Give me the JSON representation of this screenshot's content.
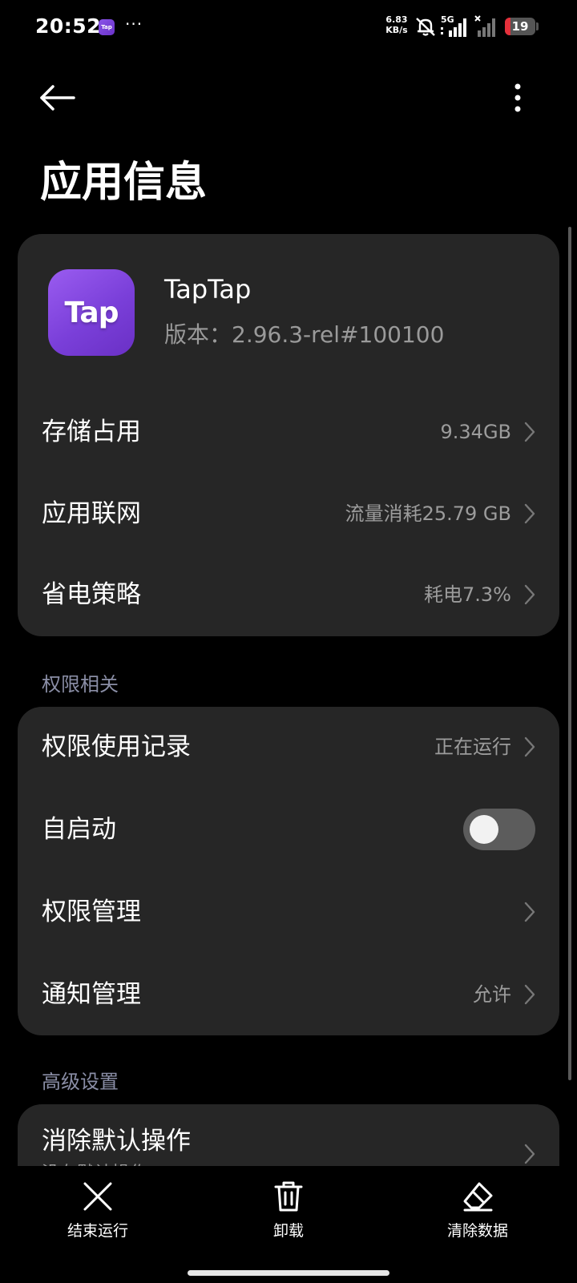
{
  "status_bar": {
    "time": "20:52",
    "app_icon_text": "Tap",
    "dots": "···",
    "net_speed_value": "6.83",
    "net_speed_unit": "KB/s",
    "network_type": "5G",
    "battery": "19",
    "battery_level": 0.19,
    "battery_color": "#e5303b"
  },
  "header": {
    "back_icon": "arrow-left-icon",
    "more_icon": "more-vertical-icon",
    "title": "应用信息"
  },
  "app": {
    "icon_text": "Tap",
    "name": "TapTap",
    "version": "版本：2.96.3-rel#100100",
    "rows": [
      {
        "label": "存储占用",
        "value": "9.34GB"
      },
      {
        "label": "应用联网",
        "value": "流量消耗25.79 GB"
      },
      {
        "label": "省电策略",
        "value": "耗电7.3%"
      }
    ]
  },
  "permissions": {
    "section_title": "权限相关",
    "usage_label": "权限使用记录",
    "usage_value": "正在运行",
    "autostart_label": "自启动",
    "autostart_enabled": false,
    "manage_label": "权限管理",
    "notify_label": "通知管理",
    "notify_value": "允许"
  },
  "advanced": {
    "section_title": "高级设置",
    "clear_default_label": "消除默认操作",
    "clear_default_sub": "没有默认操作"
  },
  "bottom_actions": [
    {
      "label": "结束运行",
      "icon": "close-icon"
    },
    {
      "label": "卸载",
      "icon": "trash-icon"
    },
    {
      "label": "清除数据",
      "icon": "eraser-icon"
    }
  ],
  "colors": {
    "background": "#000000",
    "card": "#262626",
    "secondary_text": "#9c9c9c",
    "section_header": "#8a8ea6",
    "app_icon": "#7a3fd9"
  }
}
